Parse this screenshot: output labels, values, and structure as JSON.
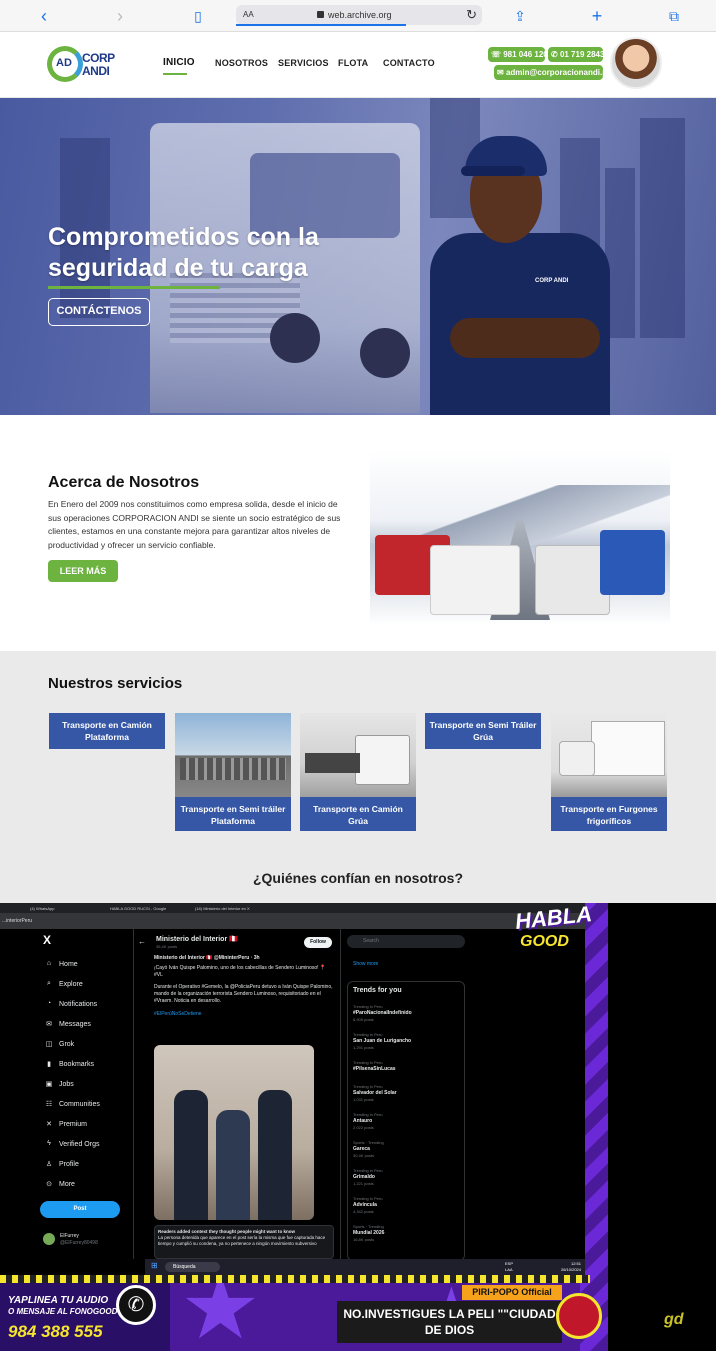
{
  "browser": {
    "aa": "AA",
    "url": "web.archive.org"
  },
  "header": {
    "logo_mark": "AD",
    "logo_line1": "CORP",
    "logo_line2": "ANDI",
    "nav": [
      "INICIO",
      "NOSOTROS",
      "SERVICIOS",
      "FLOTA",
      "CONTACTO"
    ],
    "phone1": "981 046 120",
    "phone2": "01 719 2843",
    "email": "admin@corporacionandi.pe"
  },
  "hero": {
    "title": "Comprometidos con la seguridad de tu carga",
    "button": "CONTÁCTENOS",
    "shirt_logo": "CORP ANDI"
  },
  "about": {
    "title": "Acerca de Nosotros",
    "text": "En Enero del 2009 nos constituimos como empresa solida, desde el inicio de sus operaciones CORPORACION ANDI se siente un socio estratégico de sus clientes, estamos en una constante mejora para garantizar altos niveles de productividad y ofrecer un servicio confiable.",
    "button": "LEER MÁS"
  },
  "services": {
    "title": "Nuestros servicios",
    "items": [
      "Transporte en Camión Plataforma",
      "Transporte en Semi tráiler Plataforma",
      "Transporte en Camión Grúa",
      "Transporte en Semi Tráiler Grúa",
      "Transporte en Furgones frigoríficos"
    ]
  },
  "trust_title": "¿Quiénes confían en nosotros?",
  "stream": {
    "tabs": [
      "(4) WhatsApp",
      "HABLA GOOD RUCSI - Google",
      "(18) Ministerio del Interior en X"
    ],
    "address": "...interiorPeru",
    "x_nav": [
      "Home",
      "Explore",
      "Notifications",
      "Messages",
      "Grok",
      "Bookmarks",
      "Jobs",
      "Communities",
      "Premium",
      "Verified Orgs",
      "Profile",
      "More"
    ],
    "post_button": "Post",
    "account_name": "ElFurrey",
    "account_handle": "@ElFurrey80498",
    "profile_name": "Ministerio del Interior 🇵🇪",
    "profile_posts": "35,4K posts",
    "follow": "Follow",
    "tweet_author": "Ministerio del Interior 🇵🇪 @MininterPeru · 3h",
    "tweet_lines": [
      "¡Cayó Iván Quispe Palomino, uno de los cabecillas de Sendero Luminoso! 📍 #VL",
      "Durante el Operativo #Gemelo, la @PoliciaPeru detuvo a Iván Quispe Palomino, mando de la organización terrorista Sendero Luminoso, requisitoriado en el #Vraem. Noticia en desarrollo.",
      "#ElPerúNoSeDetiene"
    ],
    "note_title": "Readers added context they thought people might want to know",
    "note_text": "La persona detenida que aparece en el post sería la misma que fue capturada hace tiempo y cumplió su condena, ya no pertenece a ningún movimiento subversivo",
    "search_placeholder": "Search",
    "show_more": "Show more",
    "trends_title": "Trends for you",
    "trends": [
      {
        "cat": "Trending in Peru",
        "name": "#ParoNacionalIndefinido",
        "count": "6,905 posts"
      },
      {
        "cat": "Trending in Peru",
        "name": "San Juan de Lurigancho",
        "count": "1,291 posts"
      },
      {
        "cat": "Trending in Peru",
        "name": "#PilsenaSinLucas",
        "count": ""
      },
      {
        "cat": "Trending in Peru",
        "name": "Salvador del Solar",
        "count": "1,031 posts"
      },
      {
        "cat": "Trending in Peru",
        "name": "Antauro",
        "count": "2,022 posts"
      },
      {
        "cat": "Sports · Trending",
        "name": "Gareca",
        "count": "30,4K posts"
      },
      {
        "cat": "Trending in Peru",
        "name": "Grimaldo",
        "count": "1,221 posts"
      },
      {
        "cat": "Trending in Peru",
        "name": "Advíncula",
        "count": "4,342 posts"
      },
      {
        "cat": "Sports · Trending",
        "name": "Mundial 2026",
        "count": "16,8K posts"
      }
    ],
    "taskbar_search": "Búsqueda",
    "clock": "12:51\n26/10/2024",
    "lang": "ESP\nLAA",
    "habla": "HABLA",
    "good": "GOOD",
    "yape_line1": "YAPLINEA TU AUDIO",
    "yape_line2": "O MENSAJE AL FONOGOOD",
    "yape_number": "984 388 555",
    "piri": "PIRI-POPO Official",
    "marquee": "NO.INVESTIGUES LA PELI \"\"CIUDAD DE DIOS",
    "corner_logo": "gd"
  },
  "colors": {
    "brand_green": "#6db33f",
    "brand_blue": "#3557a6",
    "stream_purple": "#4b1a9a",
    "stream_yellow": "#f6e52e"
  }
}
